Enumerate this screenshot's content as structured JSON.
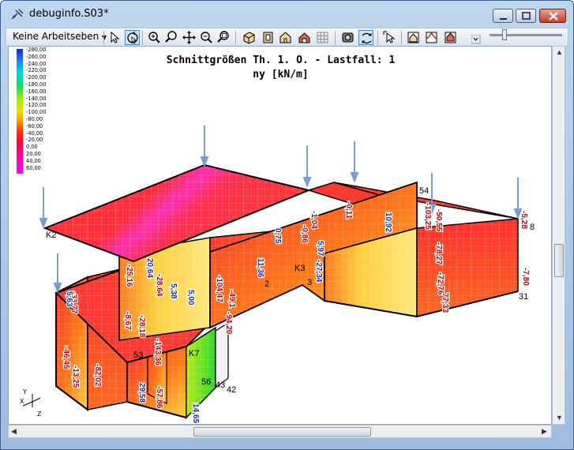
{
  "window": {
    "title": "debuginfo.S03*",
    "colors": {
      "frame": "#bfd6ef",
      "load_arrow": "#7b9ccf"
    }
  },
  "toolbar": {
    "layer_dropdown": "Keine Arbeitseben",
    "zoom_slider_value": 0.18
  },
  "plot": {
    "title_line1": "Schnittgrößen Th. 1. O. - Lastfall: 1",
    "title_line2": "ny [kN/m]",
    "legend": [
      "-280,00",
      "-260,00",
      "-240,00",
      "-220,00",
      "-200,00",
      "-180,00",
      "-160,00",
      "-140,00",
      "-120,00",
      "-100,00",
      "-80,00",
      "-60,00",
      "-40,00",
      "-20,00",
      "0,00",
      "20,00",
      "40,00",
      "60,00"
    ],
    "node_labels": [
      "K2",
      "K3",
      "K7",
      "2",
      "3",
      "54",
      "8",
      "31",
      "53",
      "56",
      "43",
      "42"
    ],
    "values_red": [
      "-0,11",
      "-1,04",
      "-0,86",
      "-50,55",
      "-103,25",
      "-5,28",
      "-78,27",
      "-72,76",
      "77,33",
      "-7,80",
      "-104,47",
      "-49,1",
      "-94,20",
      "-33,77",
      "-8,67",
      "-28,18",
      "-143,36",
      "-13,25",
      "-46,45",
      "-82,02",
      "-57,86",
      "-28,64",
      "-25,16"
    ],
    "values_blue": [
      "0,75",
      "5,97",
      "-27,34",
      "10,92",
      "11,36",
      "20,64",
      "5,38",
      "5,00",
      "5,63",
      "29,58",
      "14,65"
    ],
    "axis": {
      "y": "Y",
      "x": "X",
      "z": "Z"
    }
  }
}
